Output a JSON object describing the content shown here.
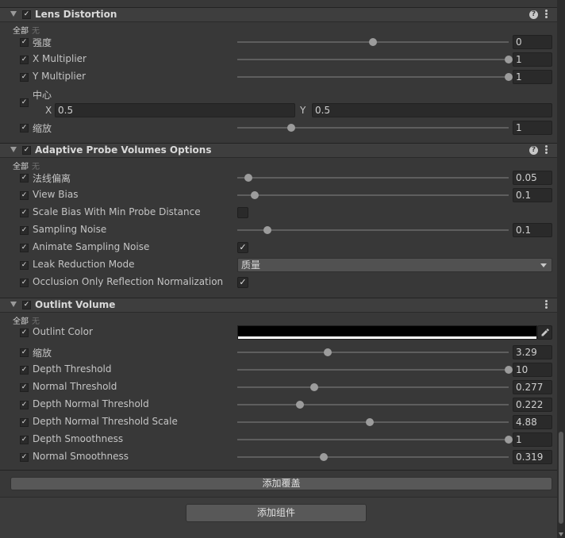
{
  "common": {
    "all_label": "全部",
    "none_label": "无",
    "check_mark": "✓"
  },
  "lens": {
    "title": "Lens Distortion",
    "rows": [
      {
        "label": "强度",
        "value": "0",
        "slider": 0.5
      },
      {
        "label": "X Multiplier",
        "value": "1",
        "slider": 1.0
      },
      {
        "label": "Y Multiplier",
        "value": "1",
        "slider": 1.0
      }
    ],
    "center": {
      "label": "中心",
      "x_label": "X",
      "x": "0.5",
      "y_label": "Y",
      "y": "0.5"
    },
    "scale": {
      "label": "缩放",
      "value": "1",
      "slider": 0.2
    }
  },
  "apv": {
    "title": "Adaptive Probe Volumes Options",
    "normal_bias": {
      "label": "法线偏离",
      "value": "0.05",
      "slider": 0.04
    },
    "view_bias": {
      "label": "View Bias",
      "value": "0.1",
      "slider": 0.064
    },
    "scale_bias": {
      "label": "Scale Bias With Min Probe Distance",
      "checked": false
    },
    "sampling_noise": {
      "label": "Sampling Noise",
      "value": "0.1",
      "slider": 0.11
    },
    "animate_noise": {
      "label": "Animate Sampling Noise",
      "checked": true
    },
    "leak_mode": {
      "label": "Leak Reduction Mode",
      "value": "质量"
    },
    "occlusion": {
      "label": "Occlusion Only Reflection Normalization",
      "checked": true
    }
  },
  "outline": {
    "title": "Outlint Volume",
    "color": {
      "label": "Outlint Color",
      "value": "#000000",
      "alpha_color": "#ffffff"
    },
    "rows": [
      {
        "key": "scale",
        "label": "缩放",
        "value": "3.29",
        "slider": 0.333
      },
      {
        "key": "depth-threshold",
        "label": "Depth Threshold",
        "value": "10",
        "slider": 1.0
      },
      {
        "key": "normal-threshold",
        "label": "Normal Threshold",
        "value": "0.277",
        "slider": 0.284
      },
      {
        "key": "depth-normal-threshold",
        "label": "Depth Normal Threshold",
        "value": "0.222",
        "slider": 0.231
      },
      {
        "key": "depth-normal-threshold-scale",
        "label": "Depth Normal Threshold Scale",
        "value": "4.88",
        "slider": 0.488
      },
      {
        "key": "depth-smoothness",
        "label": "Depth Smoothness",
        "value": "1",
        "slider": 1.0
      },
      {
        "key": "normal-smoothness",
        "label": "Normal Smoothness",
        "value": "0.319",
        "slider": 0.32
      }
    ]
  },
  "buttons": {
    "add_override": "添加覆盖",
    "add_component": "添加组件"
  },
  "theme": {
    "bg": "#383838",
    "header": "#3e3e3e",
    "field": "#2a2a2a",
    "text": "#c4c4c4"
  }
}
